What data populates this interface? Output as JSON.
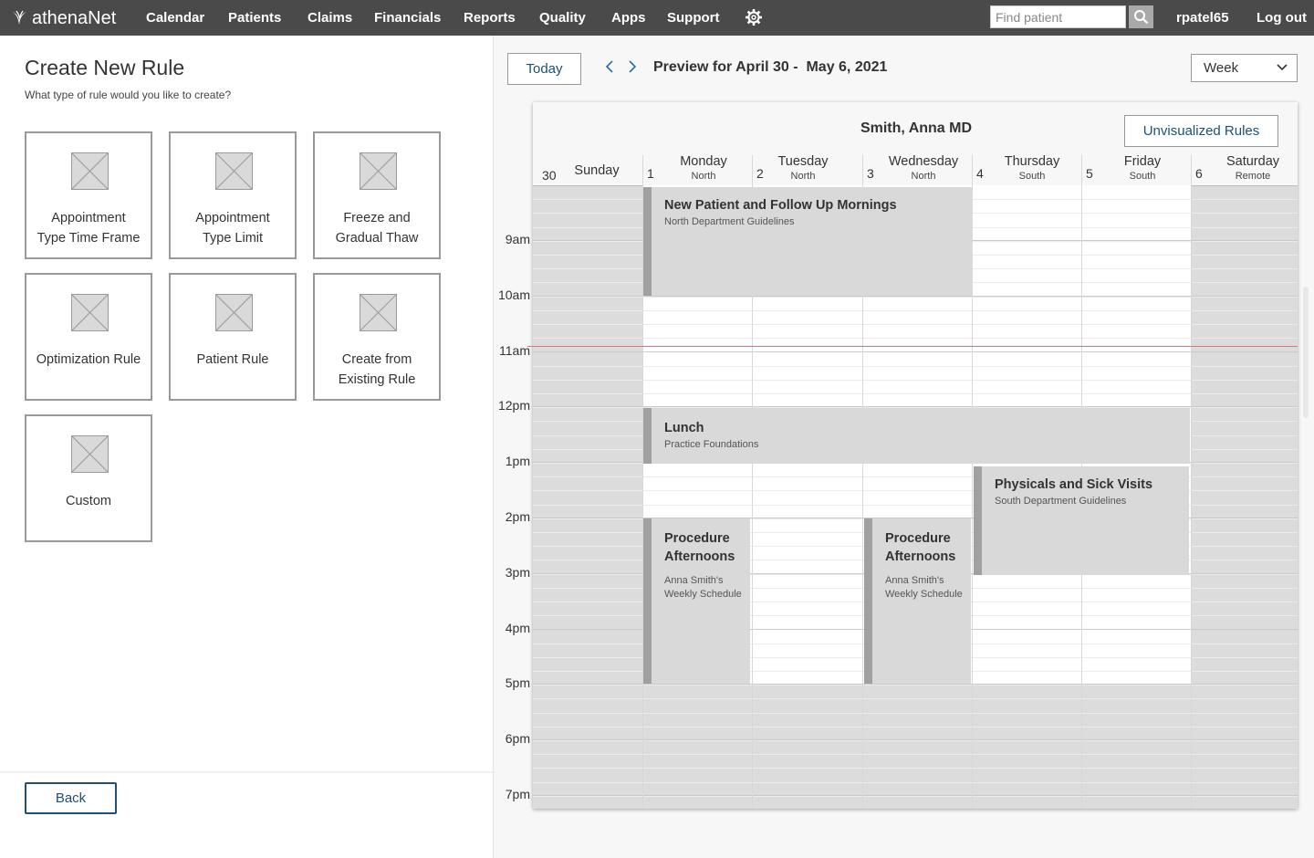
{
  "nav": {
    "brand_a": "athena",
    "brand_b": "Net",
    "items": [
      "Calendar",
      "Patients",
      "Claims",
      "Financials",
      "Reports",
      "Quality",
      "Apps",
      "Support"
    ],
    "search_placeholder": "Find patient",
    "user": "rpatel65",
    "logout": "Log out"
  },
  "left": {
    "title": "Create New Rule",
    "subtitle": "What type of rule would you like to create?",
    "tiles": [
      {
        "line1": "Appointment",
        "line2": "Type Time Frame"
      },
      {
        "line1": "Appointment",
        "line2": "Type Limit"
      },
      {
        "line1": "Freeze and",
        "line2": "Gradual Thaw"
      },
      {
        "line1": "Optimization Rule",
        "line2": ""
      },
      {
        "line1": "Patient Rule",
        "line2": ""
      },
      {
        "line1": "Create from",
        "line2": "Existing Rule"
      },
      {
        "line1": "Custom",
        "line2": ""
      }
    ],
    "back_label": "Back"
  },
  "toolbar": {
    "today_label": "Today",
    "preview_title": "Preview for April 30 -  May 6, 2021",
    "view_selected": "Week"
  },
  "calendar": {
    "provider": "Smith, Anna MD",
    "unvisualized_label": "Unvisualized Rules",
    "days": [
      {
        "num": "30",
        "name": "Sunday",
        "sub": ""
      },
      {
        "num": "1",
        "name": "Monday",
        "sub": "North"
      },
      {
        "num": "2",
        "name": "Tuesday",
        "sub": "North"
      },
      {
        "num": "3",
        "name": "Wednesday",
        "sub": "North"
      },
      {
        "num": "4",
        "name": "Thursday",
        "sub": "South"
      },
      {
        "num": "5",
        "name": "Friday",
        "sub": "South"
      },
      {
        "num": "6",
        "name": "Saturday",
        "sub": "Remote"
      }
    ],
    "hours": [
      "9am",
      "10am",
      "11am",
      "12pm",
      "1pm",
      "2pm",
      "3pm",
      "4pm",
      "5pm",
      "6pm",
      "7pm"
    ],
    "events": [
      {
        "title": "New Patient and Follow Up Mornings",
        "sub": "North Department Guidelines"
      },
      {
        "title": "Lunch",
        "sub": "Practice Foundations"
      },
      {
        "title": "Physicals and Sick Visits",
        "sub": "South Department Guidelines"
      },
      {
        "title_1": "Procedure",
        "title_2": "Afternoons",
        "sub_1": "Anna Smith's",
        "sub_2": "Weekly Schedule"
      },
      {
        "title_1": "Procedure",
        "title_2": "Afternoons",
        "sub_1": "Anna Smith's",
        "sub_2": "Weekly Schedule"
      }
    ]
  },
  "colors": {
    "topbar": "#4a4a4a",
    "link_blue": "#1a5276",
    "event_fill": "#d9d9d9",
    "event_bar": "#a0a0a0",
    "now_line": "#e57373"
  }
}
